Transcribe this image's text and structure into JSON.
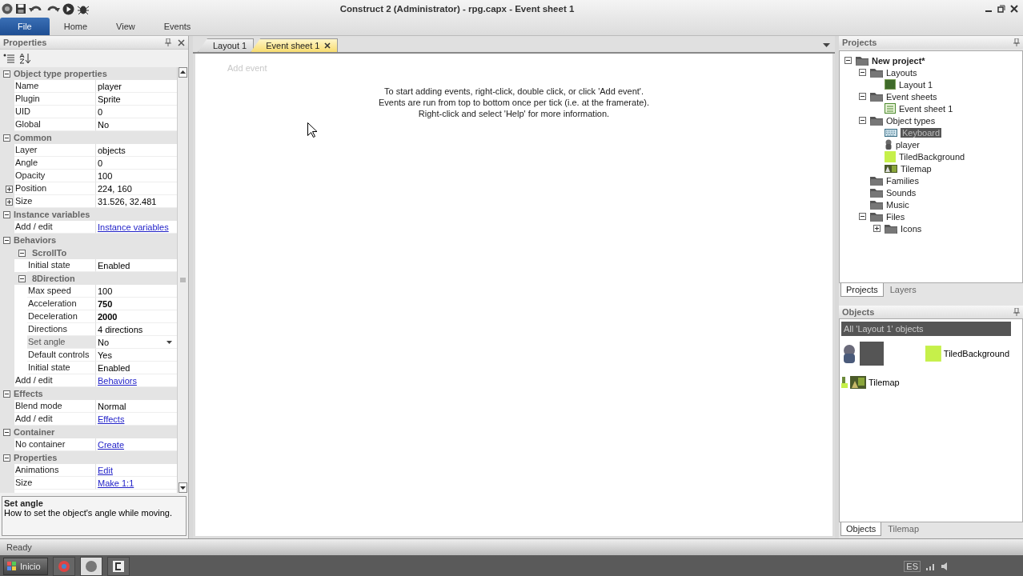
{
  "window": {
    "title": "Construct 2 (Administrator) - rpg.capx - Event sheet 1"
  },
  "ribbon_tabs": [
    {
      "label": "File",
      "selected": true
    },
    {
      "label": "Home",
      "selected": false
    },
    {
      "label": "View",
      "selected": false
    },
    {
      "label": "Events",
      "selected": false
    }
  ],
  "properties": {
    "title": "Properties",
    "sections": [
      {
        "title": "Object type properties",
        "expanded": true,
        "rows": [
          {
            "kind": "text",
            "name": "Name",
            "value": "player",
            "selected": false
          },
          {
            "kind": "text",
            "name": "Plugin",
            "value": "Sprite",
            "selected": false
          },
          {
            "kind": "text",
            "name": "UID",
            "value": "0",
            "selected": false
          },
          {
            "kind": "text",
            "name": "Global",
            "value": "No",
            "selected": false
          }
        ]
      },
      {
        "title": "Common",
        "expanded": true,
        "rows": [
          {
            "kind": "text",
            "name": "Layer",
            "value": "objects",
            "selected": false
          },
          {
            "kind": "text",
            "name": "Angle",
            "value": "0",
            "selected": false
          },
          {
            "kind": "text",
            "name": "Opacity",
            "value": "100",
            "selected": false
          },
          {
            "kind": "compound",
            "name": "Position",
            "value": "224, 160",
            "selected": false,
            "expanded": false
          },
          {
            "kind": "compound",
            "name": "Size",
            "value": "31.526, 32.481",
            "selected": false,
            "expanded": false
          }
        ]
      },
      {
        "title": "Instance variables",
        "expanded": true,
        "rows": [
          {
            "kind": "link",
            "name": "Add / edit",
            "value": "Instance variables",
            "selected": false
          }
        ]
      },
      {
        "title": "Behaviors",
        "expanded": true,
        "rows": [
          {
            "kind": "group",
            "name": "ScrollTo",
            "expanded": true,
            "children": [
              {
                "kind": "text",
                "name": "Initial state",
                "value": "Enabled",
                "selected": false
              }
            ]
          },
          {
            "kind": "group",
            "name": "8Direction",
            "expanded": true,
            "children": [
              {
                "kind": "text",
                "name": "Max speed",
                "value": "100",
                "selected": false
              },
              {
                "kind": "bold",
                "name": "Acceleration",
                "value": "750",
                "selected": false
              },
              {
                "kind": "bold",
                "name": "Deceleration",
                "value": "2000",
                "selected": false
              },
              {
                "kind": "text",
                "name": "Directions",
                "value": "4 directions",
                "selected": false
              },
              {
                "kind": "dropdown",
                "name": "Set angle",
                "value": "No",
                "selected": true
              },
              {
                "kind": "text",
                "name": "Default controls",
                "value": "Yes",
                "selected": false
              },
              {
                "kind": "text",
                "name": "Initial state",
                "value": "Enabled",
                "selected": false
              }
            ]
          },
          {
            "kind": "link",
            "name": "Add / edit",
            "value": "Behaviors",
            "selected": false
          }
        ]
      },
      {
        "title": "Effects",
        "expanded": true,
        "rows": [
          {
            "kind": "text",
            "name": "Blend mode",
            "value": "Normal",
            "selected": false
          },
          {
            "kind": "link",
            "name": "Add / edit",
            "value": "Effects",
            "selected": false
          }
        ]
      },
      {
        "title": "Container",
        "expanded": true,
        "rows": [
          {
            "kind": "link",
            "name": "No container",
            "value": "Create",
            "selected": false
          }
        ]
      },
      {
        "title": "Properties",
        "expanded": true,
        "rows": [
          {
            "kind": "link",
            "name": "Animations",
            "value": "Edit",
            "selected": false
          },
          {
            "kind": "link",
            "name": "Size",
            "value": "Make 1:1",
            "selected": false
          }
        ]
      }
    ],
    "description": {
      "title": "Set angle",
      "text": "How to set the object's angle while moving."
    }
  },
  "editor": {
    "tabs": [
      {
        "label": "Layout 1",
        "selected": false
      },
      {
        "label": "Event sheet 1",
        "selected": true
      }
    ],
    "add_event": "Add event",
    "hint": [
      "To start adding events, right-click, double click, or click 'Add event'.",
      "Events are run from top to bottom once per tick (i.e. at the framerate).",
      "Right-click and select 'Help' for more information."
    ]
  },
  "projects": {
    "title": "Projects",
    "tree": [
      {
        "label": "New project*",
        "kind": "folder",
        "selected": false,
        "expanded": true,
        "children": [
          {
            "label": "Layouts",
            "kind": "folder",
            "selected": false,
            "expanded": true,
            "children": [
              {
                "label": "Layout 1",
                "kind": "layout",
                "selected": false
              }
            ]
          },
          {
            "label": "Event sheets",
            "kind": "folder",
            "selected": false,
            "expanded": true,
            "children": [
              {
                "label": "Event sheet 1",
                "kind": "eventsheet",
                "selected": false
              }
            ]
          },
          {
            "label": "Object types",
            "kind": "folder",
            "selected": false,
            "expanded": true,
            "children": [
              {
                "label": "Keyboard",
                "kind": "keyboard",
                "selected": true
              },
              {
                "label": "player",
                "kind": "sprite",
                "selected": false
              },
              {
                "label": "TiledBackground",
                "kind": "tiledbg",
                "selected": false
              },
              {
                "label": "Tilemap",
                "kind": "tilemap",
                "selected": false
              }
            ]
          },
          {
            "label": "Families",
            "kind": "folder",
            "selected": false
          },
          {
            "label": "Sounds",
            "kind": "folder",
            "selected": false
          },
          {
            "label": "Music",
            "kind": "folder",
            "selected": false
          },
          {
            "label": "Files",
            "kind": "folder",
            "selected": false,
            "expanded": true,
            "children": [
              {
                "label": "Icons",
                "kind": "folder",
                "selected": false,
                "expanded": false
              }
            ]
          }
        ]
      }
    ],
    "tabs": [
      {
        "label": "Projects",
        "selected": true
      },
      {
        "label": "Layers",
        "selected": false
      }
    ]
  },
  "objects": {
    "title": "Objects",
    "filter": "All 'Layout 1' objects",
    "items": [
      {
        "kind": "sprite"
      },
      {
        "kind": "tiledbg",
        "label": "TiledBackground"
      },
      {
        "kind": "tilemap",
        "label": "Tilemap"
      }
    ],
    "tabs": [
      {
        "label": "Objects",
        "selected": true
      },
      {
        "label": "Tilemap",
        "selected": false
      }
    ]
  },
  "status_bar": {
    "text": "Ready"
  },
  "taskbar": {
    "start": "Inicio",
    "language": "ES"
  }
}
